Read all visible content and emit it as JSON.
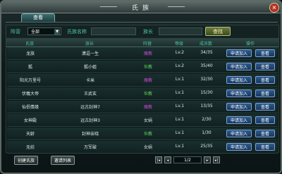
{
  "window": {
    "title": "氏族",
    "close_label": "×"
  },
  "tabs": [
    {
      "label": "查看"
    }
  ],
  "filter": {
    "camp_label": "阵营",
    "camp_value": "全部",
    "clan_name_label": "氏族名称",
    "leader_label": "族长",
    "search_label": "查找"
  },
  "table": {
    "headers": {
      "name": "氏族",
      "leader": "族长",
      "camp": "阵营",
      "level": "等级",
      "members": "成员数",
      "actions": "操作"
    },
    "rows": [
      {
        "name": "龙族",
        "leader": "潇逗一生",
        "camp": "魔教",
        "level": "Lv.2",
        "members": "34/35",
        "apply": "申请加入",
        "view": "查看"
      },
      {
        "name": "狐",
        "leader": "狐小姐",
        "camp": "伙教",
        "level": "Lv.2",
        "members": "35/40",
        "apply": "申请加入",
        "view": "查看"
      },
      {
        "name": "阳光万里号",
        "leader": "卡米",
        "camp": "魔教",
        "level": "Lv.1",
        "members": "32/30",
        "apply": "申请加入",
        "view": "查看"
      },
      {
        "name": "伏羲大帝",
        "leader": "王武玄",
        "camp": "伙教",
        "level": "Lv.1",
        "members": "15/30",
        "apply": "申请加入",
        "view": "查看"
      },
      {
        "name": "仙侣情缘",
        "leader": "远古封神7",
        "camp": "魔教",
        "level": "Lv.1",
        "members": "13/35",
        "apply": "申请加入",
        "view": "查看"
      },
      {
        "name": "女神殿",
        "leader": "远古封神3",
        "camp": "女娲",
        "level": "Lv.1",
        "members": "2/30",
        "apply": "申请加入",
        "view": "查看"
      },
      {
        "name": "天龄",
        "leader": "封神亲晓",
        "camp": "伙教",
        "level": "Lv.1",
        "members": "1/30",
        "apply": "申请加入",
        "view": "查看"
      },
      {
        "name": "无妨",
        "leader": "万军破",
        "camp": "女娲",
        "level": "Lv.1",
        "members": "25/35",
        "apply": "申请加入",
        "view": "查看"
      }
    ]
  },
  "camp_colors": {
    "魔教": "#c44bd8",
    "伙教": "#5cd65a",
    "女娲": "#d6ddd8"
  },
  "footer": {
    "create_clan": "创建氏族",
    "invite_list": "邀请列表",
    "page": "1/2",
    "first": "|◂",
    "prev": "◂",
    "next": "▸",
    "last": "▸|"
  }
}
